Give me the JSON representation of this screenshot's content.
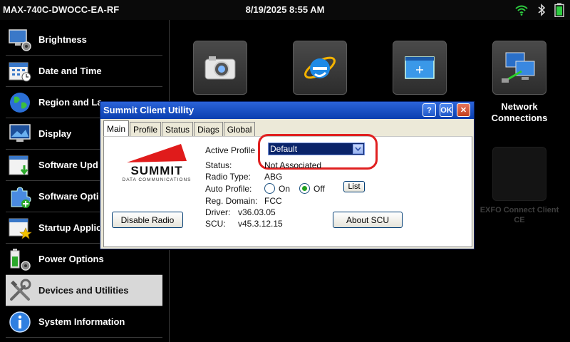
{
  "status_bar": {
    "device_name": "MAX-740C-DWOCC-EA-RF",
    "datetime": "8/19/2025 8:55 AM",
    "icons": [
      "wifi-icon",
      "bluetooth-icon",
      "battery-icon"
    ]
  },
  "sidebar": {
    "items": [
      {
        "label": "Brightness",
        "icon": "monitor-gear-icon"
      },
      {
        "label": "Date and Time",
        "icon": "calendar-clock-icon"
      },
      {
        "label": "Region and La",
        "icon": "globe-icon"
      },
      {
        "label": "Display",
        "icon": "display-icon"
      },
      {
        "label": "Software Upd",
        "icon": "software-update-icon"
      },
      {
        "label": "Software Opti",
        "icon": "puzzle-icon"
      },
      {
        "label": "Startup Applic",
        "icon": "startup-star-icon"
      },
      {
        "label": "Power Options",
        "icon": "battery-gear-icon"
      },
      {
        "label": "Devices and Utilities",
        "icon": "tools-icon",
        "selected": true
      },
      {
        "label": "System Information",
        "icon": "info-icon"
      }
    ]
  },
  "desktop": {
    "network_connections_label": "Network Connections",
    "faded_label": "EXFO Connect Client CE"
  },
  "dialog": {
    "title": "Summit Client Utility",
    "help_label": "?",
    "ok_label": "OK",
    "close_label": "✕",
    "tabs": [
      "Main",
      "Profile",
      "Status",
      "Diags",
      "Global"
    ],
    "active_tab": "Main",
    "logo_text": "SUMMIT",
    "logo_subtext": "DATA COMMUNICATIONS",
    "active_profile_label": "Active Profile",
    "active_profile_value": "Default",
    "status_label": "Status:",
    "status_value": "Not Associated",
    "radio_type_label": "Radio Type:",
    "radio_type_value": "ABG",
    "auto_profile_label": "Auto Profile:",
    "auto_profile_on": "On",
    "auto_profile_off": "Off",
    "auto_profile_selected": "Off",
    "list_button": "List",
    "reg_domain_label": "Reg. Domain:",
    "reg_domain_value": "FCC",
    "driver_label": "Driver:",
    "driver_value": "v36.03.05",
    "scu_label": "SCU:",
    "scu_value": "v45.3.12.15",
    "disable_radio_button": "Disable Radio",
    "about_button": "About SCU"
  },
  "colors": {
    "accent_blue": "#0a3fb0",
    "highlight_red": "#e02020",
    "wifi_green": "#2ecc40",
    "selected_item": "#d8d8d8"
  }
}
